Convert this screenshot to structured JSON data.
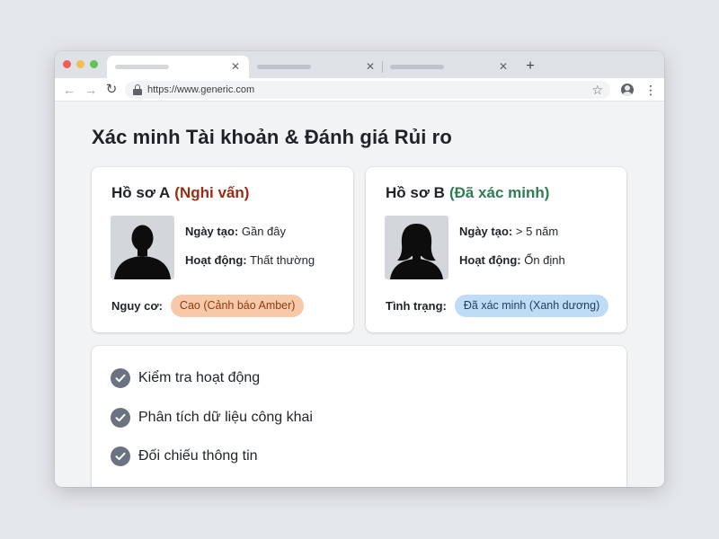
{
  "browser": {
    "url": "https://www.generic.com"
  },
  "page": {
    "title": "Xác minh Tài khoản & Đánh giá Rủi ro"
  },
  "profile_a": {
    "title": "Hồ sơ A",
    "status": "(Nghi vấn)",
    "status_color": "#9b2c14",
    "created_key": "Ngày tạo:",
    "created_value": "Gần đây",
    "activity_key": "Hoạt động:",
    "activity_value": "Thất thường",
    "risk_label": "Nguy cơ:",
    "risk_badge": "Cao (Cảnh báo Amber)",
    "badge_color": "#f8c9a9",
    "avatar": "male-silhouette"
  },
  "profile_b": {
    "title": "Hồ sơ B",
    "status": "(Đã xác minh)",
    "status_color": "#2e7d55",
    "created_key": "Ngày tạo:",
    "created_value": "> 5 năm",
    "activity_key": "Hoạt động:",
    "activity_value": "Ổn định",
    "state_label": "Tình trạng:",
    "state_badge": "Đã xác minh (Xanh dương)",
    "badge_color": "#bfdcf6",
    "avatar": "female-silhouette"
  },
  "checklist": {
    "items": [
      "Kiểm tra hoạt động",
      "Phân tích dữ liệu công khai",
      "Đối chiếu thông tin"
    ],
    "icon": "check-circle-icon"
  }
}
